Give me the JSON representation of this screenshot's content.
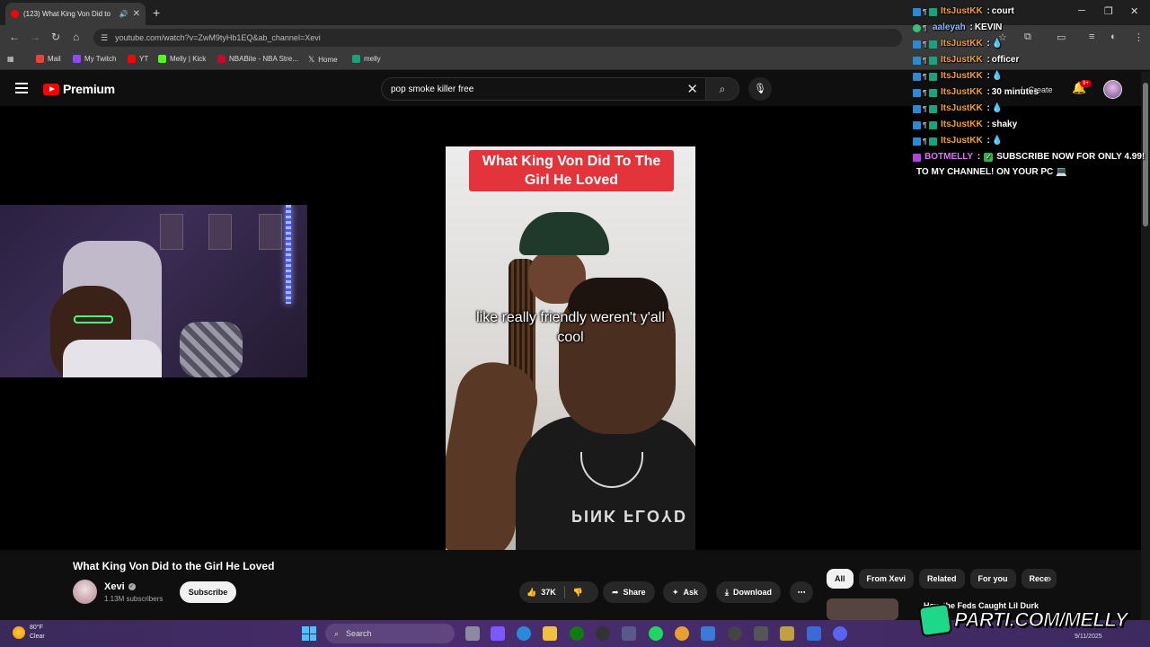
{
  "browser": {
    "tab_title": "(123) What King Von Did to",
    "url": "youtube.com/watch?v=ZwM9tyHb1EQ&ab_channel=Xevi",
    "bookmarks": [
      {
        "label": "Mail",
        "color": "#ea4335"
      },
      {
        "label": "My Twitch",
        "color": "#9146ff"
      },
      {
        "label": "YT",
        "color": "#ff0000"
      },
      {
        "label": "Melly | Kick",
        "color": "#53fc18"
      },
      {
        "label": "NBABite - NBA Stre...",
        "color": "#c9082a"
      },
      {
        "label": "Home",
        "color": "#ffffff"
      },
      {
        "label": "melly",
        "color": "#1aa37a"
      }
    ]
  },
  "youtube": {
    "brand": "Premium",
    "search_value": "pop smoke killer free",
    "create_label": "Create",
    "notif_count": "9+"
  },
  "video": {
    "overlay_caption": "What King Von Did To The Girl He Loved",
    "subtitle": "like really friendly weren't y'all cool",
    "shirt_text": "PINK FLOYD"
  },
  "info": {
    "title": "What King Von Did to the Girl He Loved",
    "channel": "Xevi",
    "subscribers": "1.13M subscribers",
    "subscribe_label": "Subscribe",
    "likes": "37K",
    "share_label": "Share",
    "ask_label": "Ask",
    "download_label": "Download",
    "chips": [
      "All",
      "From Xevi",
      "Related",
      "For you",
      "Rece"
    ],
    "rec_title": "How the Feds Caught Lil Durk"
  },
  "chat": [
    {
      "user": "ItsJustKK",
      "text": "court",
      "style": "user"
    },
    {
      "user": "aaleyah",
      "text": "KEVIN",
      "style": "alt"
    },
    {
      "user": "ItsJustKK",
      "text": "💧",
      "style": "user"
    },
    {
      "user": "ItsJustKK",
      "text": "officer",
      "style": "user"
    },
    {
      "user": "ItsJustKK",
      "text": "💧",
      "style": "user"
    },
    {
      "user": "ItsJustKK",
      "text": "30 minutes",
      "style": "user"
    },
    {
      "user": "ItsJustKK",
      "text": "💧",
      "style": "user"
    },
    {
      "user": "ItsJustKK",
      "text": "shaky",
      "style": "user"
    },
    {
      "user": "ItsJustKK",
      "text": "💧",
      "style": "user"
    }
  ],
  "bot": {
    "user": "BOTMELLY",
    "line1": "SUBSCRIBE NOW FOR ONLY 4.99!",
    "line2": "TO MY CHANNEL! ON YOUR PC 💻"
  },
  "taskbar": {
    "temp": "80°F",
    "cond": "Clear",
    "search_label": "Search",
    "date": "9/11/2025"
  },
  "overlay_logo": "PARTI.COM/MELLY"
}
